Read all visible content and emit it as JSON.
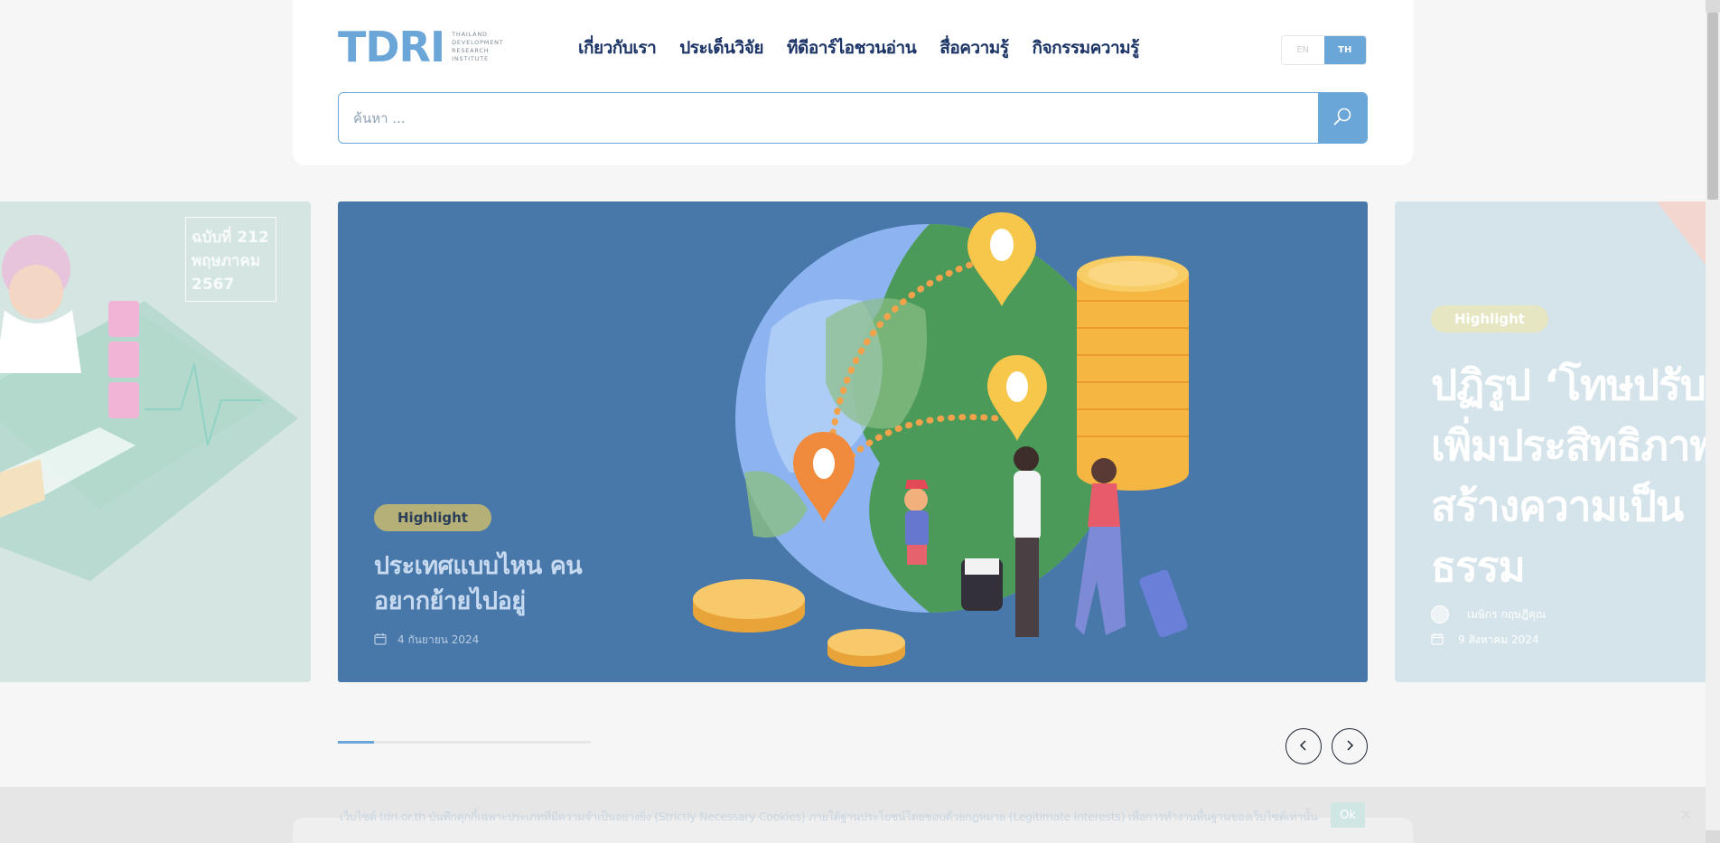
{
  "logo": {
    "mark": "TDRI",
    "sub1": "THAILAND",
    "sub2": "DEVELOPMENT",
    "sub3": "RESEARCH",
    "sub4": "INSTITUTE"
  },
  "nav": {
    "items": [
      {
        "label": "เกี่ยวกับเรา"
      },
      {
        "label": "ประเด็นวิจัย"
      },
      {
        "label": "ทีดีอาร์ไอชวนอ่าน"
      },
      {
        "label": "สื่อความรู้"
      },
      {
        "label": "กิจกรรมความรู้"
      }
    ]
  },
  "lang": {
    "en": "EN",
    "th": "TH",
    "active": "TH"
  },
  "search": {
    "placeholder": "ค้นหา ..."
  },
  "slides": {
    "left": {
      "issue": [
        "ฉบับที่ 212",
        "พฤษภาคม",
        "2567"
      ]
    },
    "main": {
      "badge": "Highlight",
      "title": "ประเทศแบบไหน คนอยากย้ายไปอยู่",
      "date": "4 กันยายน 2024"
    },
    "right": {
      "badge": "Highlight",
      "title_lines": [
        "ปฏิรูป ‘โทษปรับ",
        "เพิ่มประสิทธิภาพ",
        "สร้างความเป็น",
        "ธรรม"
      ],
      "author": "เมษิกร กฤษฎีคุณ",
      "date": "9 สิงหาคม 2024"
    }
  },
  "carousel": {
    "total": 7,
    "active_index": 0
  },
  "cookie": {
    "text": "เว็บไซต์ tdri.or.th บันทึกคุกกี้เฉพาะประเภทที่มีความจำเป็นอย่างยิ่ง (Strictly Necessary Cookies) ภายใต้ฐานประโยชน์โดยชอบด้วยกฎหมาย (Legitimate Interests) เพื่อการทำงานพื้นฐานของเว็บไซต์เท่านั้น",
    "ok_label": "Ok"
  },
  "colors": {
    "brand": "#6aa6d8",
    "nav_text": "#1c3566",
    "slide_bg": "#4878aa",
    "highlight_badge": "#b5b078"
  }
}
